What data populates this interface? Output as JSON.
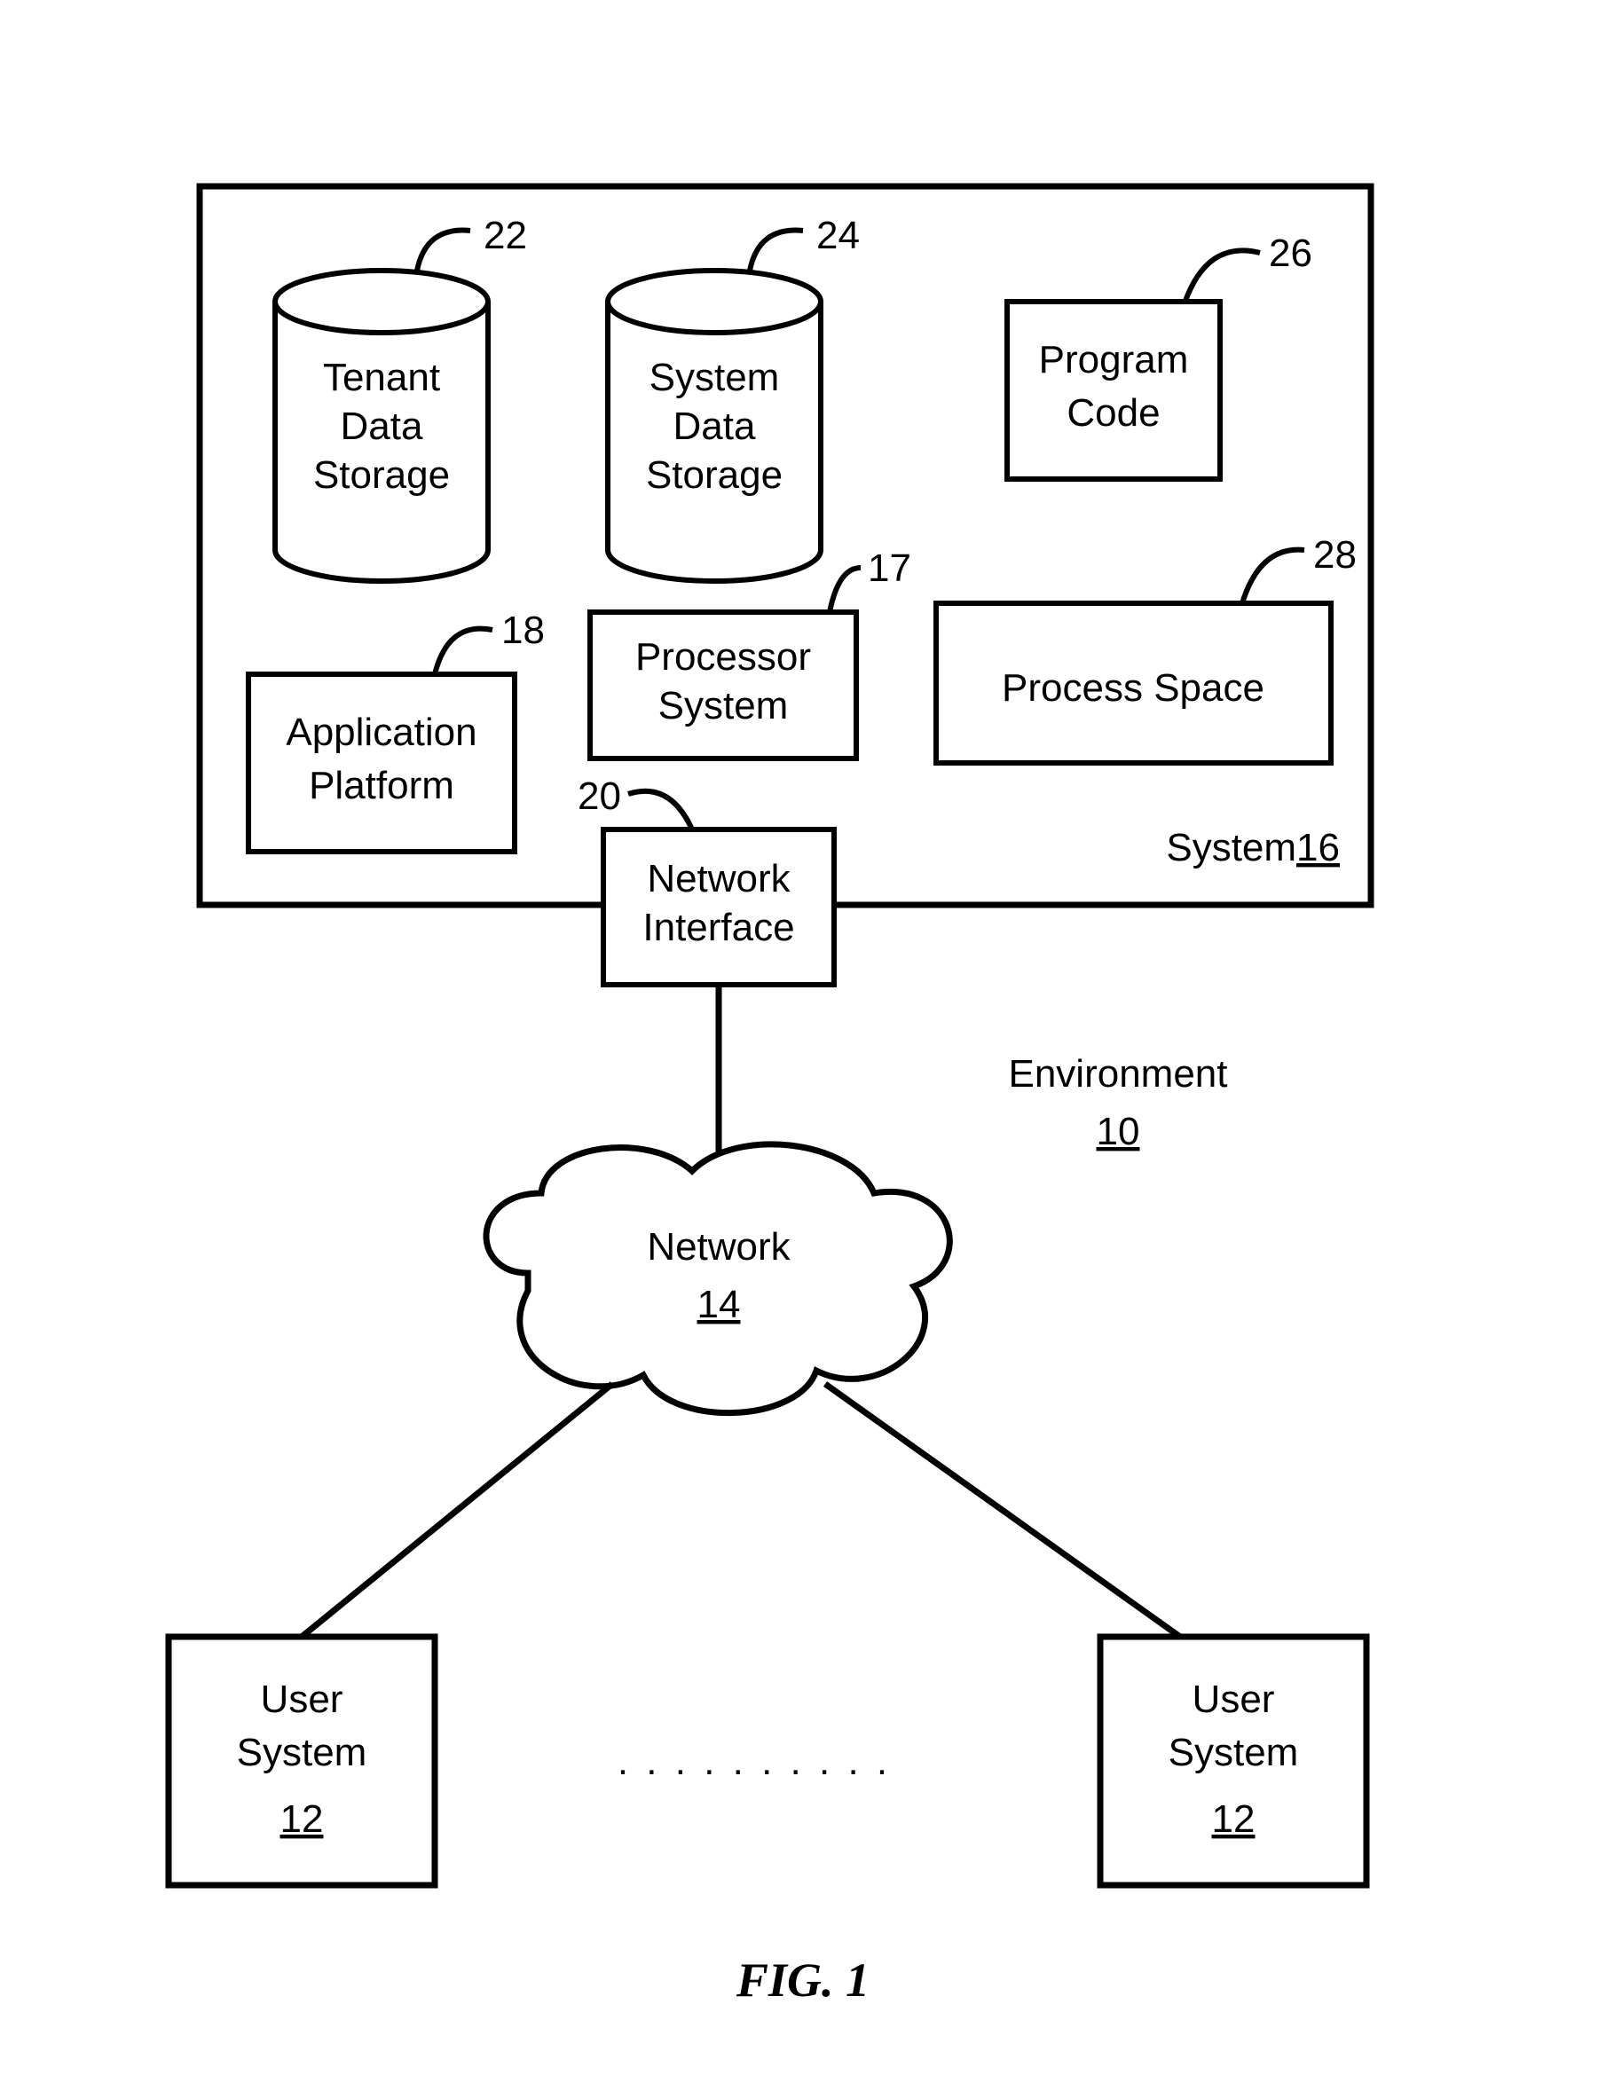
{
  "figure_label": "FIG. 1",
  "environment": {
    "label": "Environment",
    "ref": "10"
  },
  "system_container": {
    "label": "System",
    "ref": "16"
  },
  "tenant_data_storage": {
    "l1": "Tenant",
    "l2": "Data",
    "l3": "Storage",
    "ref": "22"
  },
  "system_data_storage": {
    "l1": "System",
    "l2": "Data",
    "l3": "Storage",
    "ref": "24"
  },
  "program_code": {
    "l1": "Program",
    "l2": "Code",
    "ref": "26"
  },
  "processor_system": {
    "l1": "Processor",
    "l2": "System",
    "ref": "17"
  },
  "application_platform": {
    "l1": "Application",
    "l2": "Platform",
    "ref": "18"
  },
  "process_space": {
    "l1": "Process Space",
    "ref": "28"
  },
  "network_interface": {
    "l1": "Network",
    "l2": "Interface",
    "ref": "20"
  },
  "network": {
    "l1": "Network",
    "ref": "14"
  },
  "user_system_left": {
    "l1": "User",
    "l2": "System",
    "ref": "12"
  },
  "user_system_right": {
    "l1": "User",
    "l2": "System",
    "ref": "12"
  },
  "ellipsis": ". . . . . . . . . ."
}
